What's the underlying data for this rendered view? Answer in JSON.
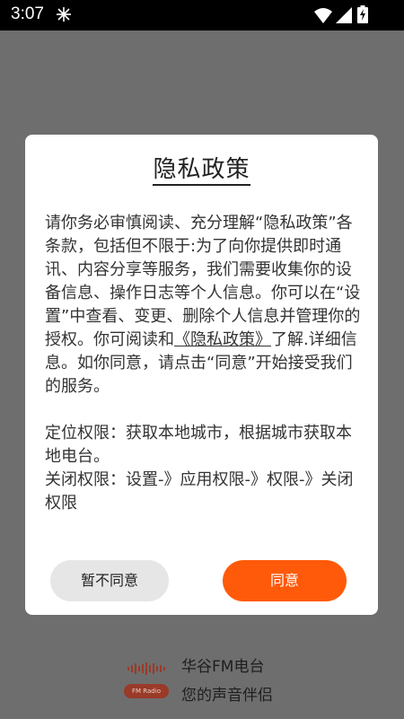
{
  "status_bar": {
    "time": "3:07",
    "icons": [
      "fan-icon",
      "wifi-icon",
      "signal-icon",
      "battery-charging-icon"
    ]
  },
  "background_brand": {
    "name": "华谷FM电台",
    "slogan": "您的声音伴侣",
    "logo_badge_text": "FM Radio"
  },
  "dialog": {
    "title": "隐私政策",
    "body_pre": "请你务必审慎阅读、充分理解“隐私政策”各条款，包括但不限于:为了向你提供即时通讯、内容分享等服务，我们需要收集你的设备信息、操作日志等个人信息。你可以在“设置”中查看、变更、删除个人信息并管理你的授权。你可阅读和",
    "policy_link": "《隐私政策》",
    "body_post": "了解.详细信息。如你同意，请点击“同意”开始接受我们的服务。",
    "location_permission": "定位权限：获取本地城市，根据城市获取本地电台。",
    "close_permission": "关闭权限：设置-》应用权限-》权限-》关闭权限",
    "disagree_label": "暂不同意",
    "agree_label": "同意"
  },
  "colors": {
    "overlay": "#6e6e6e",
    "accent": "#ff5a0a",
    "secondary_button": "#e6e6e6"
  }
}
